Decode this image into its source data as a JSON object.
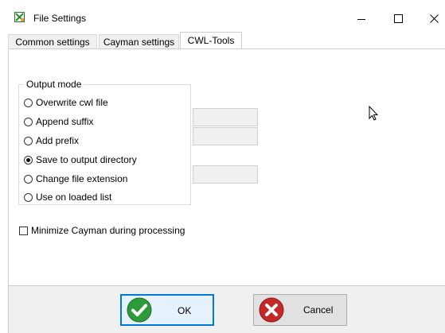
{
  "window": {
    "title": "File Settings",
    "icons": {
      "app": "file-settings-app-icon",
      "minimize": "minimize-icon",
      "maximize": "maximize-icon",
      "close": "close-icon"
    }
  },
  "tabs": [
    {
      "label": "Common settings",
      "active": false
    },
    {
      "label": "Cayman settings",
      "active": false
    },
    {
      "label": "CWL-Tools",
      "active": true
    }
  ],
  "output_mode": {
    "legend": "Output mode",
    "options": [
      {
        "label": "Overwrite cwl file",
        "selected": false
      },
      {
        "label": "Append suffix",
        "selected": false
      },
      {
        "label": "Add prefix",
        "selected": false
      },
      {
        "label": "Save to output directory",
        "selected": true
      },
      {
        "label": "Change file extension",
        "selected": false
      },
      {
        "label": "Use on loaded list",
        "selected": false
      }
    ],
    "suffix_value": "",
    "prefix_value": "",
    "extension_value": ""
  },
  "minimize_option": {
    "label": "Minimize Cayman during processing",
    "checked": false
  },
  "buttons": {
    "ok": {
      "label": "OK",
      "icon": "checkmark-icon"
    },
    "cancel": {
      "label": "Cancel",
      "icon": "x-icon"
    }
  },
  "colors": {
    "ok_green": "#2e9b3a",
    "cancel_red": "#c62828",
    "focus_blue": "#0078d7"
  }
}
